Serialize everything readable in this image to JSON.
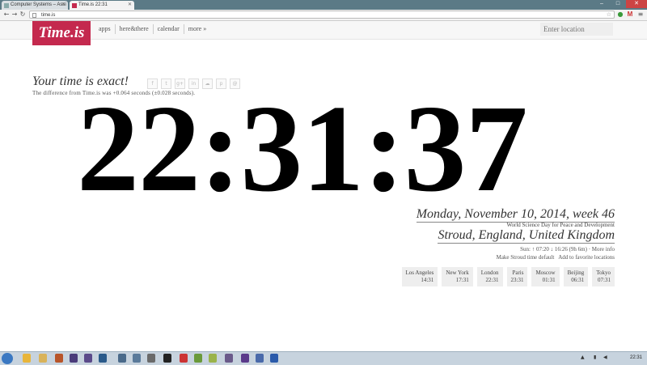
{
  "browser": {
    "tabs": [
      {
        "title": "Computer Systems – Assi"
      },
      {
        "title": "Time.is 22:31"
      }
    ],
    "url": "time.is",
    "window_buttons": [
      "–",
      "□",
      "✕"
    ]
  },
  "site": {
    "logo": "Time.is",
    "menu": [
      "apps",
      "here&there",
      "calendar",
      "more »"
    ],
    "location_placeholder": "Enter location"
  },
  "main": {
    "exact": "Your time is exact!",
    "share_icons": [
      "f",
      "t",
      "g+",
      "in",
      "☁",
      "p",
      "@"
    ],
    "diff": "The difference from Time.is was +0.064 seconds (±0.028 seconds).",
    "clock": "22:31:37",
    "date": "Monday, November 10, 2014, week 46",
    "holiday": "World Science Day for Peace and Development",
    "location": "Stroud, England, United Kingdom",
    "sun_text": "Sun: ↑ 07:20 ↓ 16:26 (9h 6m) ·",
    "more_info": "More info",
    "make_default": "Make Stroud time default",
    "add_favorite": "Add to favorite locations",
    "cities": [
      {
        "name": "Los Angeles",
        "time": "14:31"
      },
      {
        "name": "New York",
        "time": "17:31"
      },
      {
        "name": "London",
        "time": "22:31"
      },
      {
        "name": "Paris",
        "time": "23:31"
      },
      {
        "name": "Moscow",
        "time": "01:31"
      },
      {
        "name": "Beijing",
        "time": "06:31"
      },
      {
        "name": "Tokyo",
        "time": "07:31"
      }
    ]
  },
  "taskbar": {
    "clock": "22:31"
  },
  "colors": {
    "brand": "#c4294e"
  }
}
